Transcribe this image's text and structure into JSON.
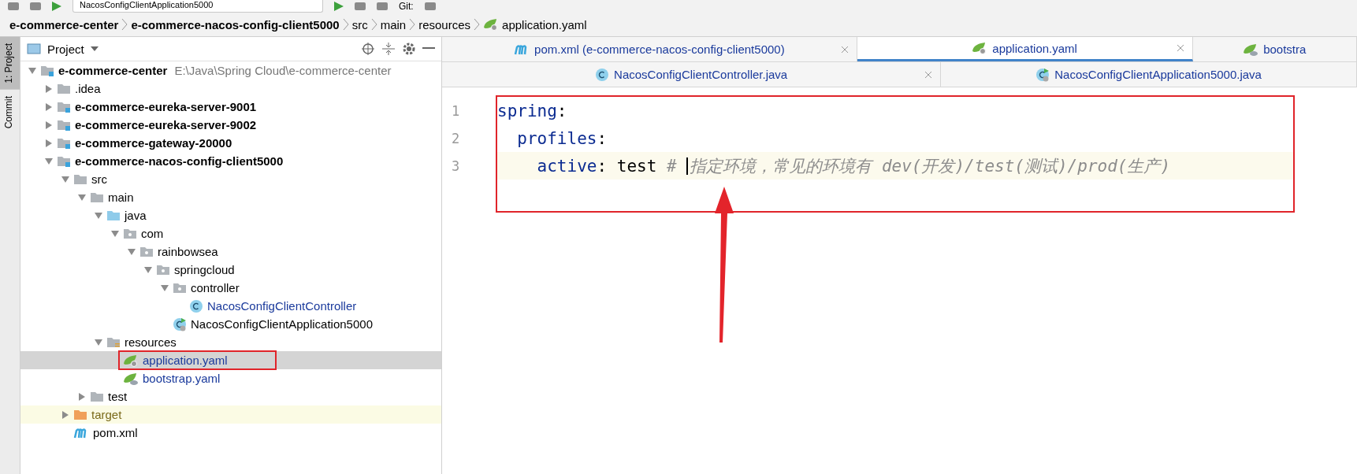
{
  "toolbar": {
    "run_config": "NacosConfigClientApplication5000",
    "git_label": "Git:"
  },
  "breadcrumbs": [
    {
      "label": "e-commerce-center",
      "kind": "module"
    },
    {
      "label": "e-commerce-nacos-config-client5000",
      "kind": "module"
    },
    {
      "label": "src",
      "kind": "folder"
    },
    {
      "label": "main",
      "kind": "folder"
    },
    {
      "label": "resources",
      "kind": "folder"
    },
    {
      "label": "application.yaml",
      "kind": "spring-yaml"
    }
  ],
  "tool_stripe": [
    {
      "label": "1: Project",
      "selected": true
    },
    {
      "label": "Commit",
      "selected": false
    }
  ],
  "project_panel": {
    "title": "Project",
    "tree": [
      {
        "label": "e-commerce-center",
        "detail": "E:\\Java\\Spring Cloud\\e-commerce-center",
        "kind": "module",
        "expanded": true,
        "selected": false,
        "annotated": false,
        "children": [
          {
            "label": ".idea",
            "kind": "folder",
            "expanded": false,
            "selected": false,
            "annotated": false
          },
          {
            "label": "e-commerce-eureka-server-9001",
            "kind": "module",
            "expanded": false,
            "selected": false,
            "annotated": false
          },
          {
            "label": "e-commerce-eureka-server-9002",
            "kind": "module",
            "expanded": false,
            "selected": false,
            "annotated": false
          },
          {
            "label": "e-commerce-gateway-20000",
            "kind": "module",
            "expanded": false,
            "selected": false,
            "annotated": false
          },
          {
            "label": "e-commerce-nacos-config-client5000",
            "kind": "module",
            "expanded": true,
            "selected": false,
            "annotated": false,
            "children": [
              {
                "label": "src",
                "kind": "folder",
                "expanded": true,
                "selected": false,
                "annotated": false,
                "children": [
                  {
                    "label": "main",
                    "kind": "folder",
                    "expanded": true,
                    "selected": false,
                    "annotated": false,
                    "children": [
                      {
                        "label": "java",
                        "kind": "source-folder",
                        "expanded": true,
                        "selected": false,
                        "annotated": false,
                        "children": [
                          {
                            "label": "com",
                            "kind": "package",
                            "expanded": true,
                            "selected": false,
                            "annotated": false,
                            "children": [
                              {
                                "label": "rainbowsea",
                                "kind": "package",
                                "expanded": true,
                                "selected": false,
                                "annotated": false,
                                "children": [
                                  {
                                    "label": "springcloud",
                                    "kind": "package",
                                    "expanded": true,
                                    "selected": false,
                                    "annotated": false,
                                    "children": [
                                      {
                                        "label": "controller",
                                        "kind": "package",
                                        "expanded": true,
                                        "selected": false,
                                        "annotated": false,
                                        "children": [
                                          {
                                            "label": "NacosConfigClientController",
                                            "kind": "class",
                                            "selected": false,
                                            "annotated": false
                                          }
                                        ]
                                      },
                                      {
                                        "label": "NacosConfigClientApplication5000",
                                        "kind": "boot-class",
                                        "selected": false,
                                        "annotated": false
                                      }
                                    ]
                                  }
                                ]
                              }
                            ]
                          }
                        ]
                      },
                      {
                        "label": "resources",
                        "kind": "resource-folder",
                        "expanded": true,
                        "selected": false,
                        "annotated": false,
                        "children": [
                          {
                            "label": "application.yaml",
                            "kind": "spring-yaml",
                            "selected": true,
                            "annotated": true
                          },
                          {
                            "label": "bootstrap.yaml",
                            "kind": "bootstrap-yaml",
                            "selected": false,
                            "annotated": false
                          }
                        ]
                      }
                    ]
                  },
                  {
                    "label": "test",
                    "kind": "folder",
                    "expanded": false,
                    "selected": false,
                    "annotated": false
                  }
                ]
              },
              {
                "label": "target",
                "kind": "excluded-folder",
                "expanded": false,
                "selected": false,
                "annotated": false
              },
              {
                "label": "pom.xml",
                "kind": "maven",
                "selected": false,
                "annotated": false
              }
            ]
          }
        ]
      }
    ]
  },
  "editor": {
    "tab_rows": [
      [
        {
          "label": "pom.xml (e-commerce-nacos-config-client5000)",
          "kind": "maven",
          "selected": false,
          "closable": true
        },
        {
          "label": "application.yaml",
          "kind": "spring-yaml",
          "selected": true,
          "closable": true
        },
        {
          "label": "bootstra",
          "kind": "bootstrap-yaml",
          "selected": false,
          "closable": false
        }
      ],
      [
        {
          "label": "NacosConfigClientController.java",
          "kind": "class",
          "selected": false,
          "closable": true
        },
        {
          "label": "NacosConfigClientApplication5000.java",
          "kind": "boot-class",
          "selected": false,
          "closable": false
        }
      ]
    ],
    "annotated": true,
    "lines": [
      {
        "number": "1",
        "current": false,
        "tokens": [
          {
            "text": "spring",
            "kind": "key"
          },
          {
            "text": ":",
            "kind": "punct"
          }
        ]
      },
      {
        "number": "2",
        "current": false,
        "tokens": [
          {
            "text": "  profiles",
            "kind": "key"
          },
          {
            "text": ":",
            "kind": "punct"
          }
        ]
      },
      {
        "number": "3",
        "current": true,
        "tokens": [
          {
            "text": "    active",
            "kind": "key"
          },
          {
            "text": ": ",
            "kind": "punct"
          },
          {
            "text": "test ",
            "kind": "value"
          },
          {
            "text": "# ",
            "kind": "comment",
            "caret": false
          },
          {
            "text": "指定环境，常见的环境有 dev(开发)/test(测试)/prod(生产)",
            "kind": "comment",
            "caret": true
          }
        ]
      }
    ],
    "annotations": [
      {
        "kind": "arrow"
      }
    ]
  }
}
